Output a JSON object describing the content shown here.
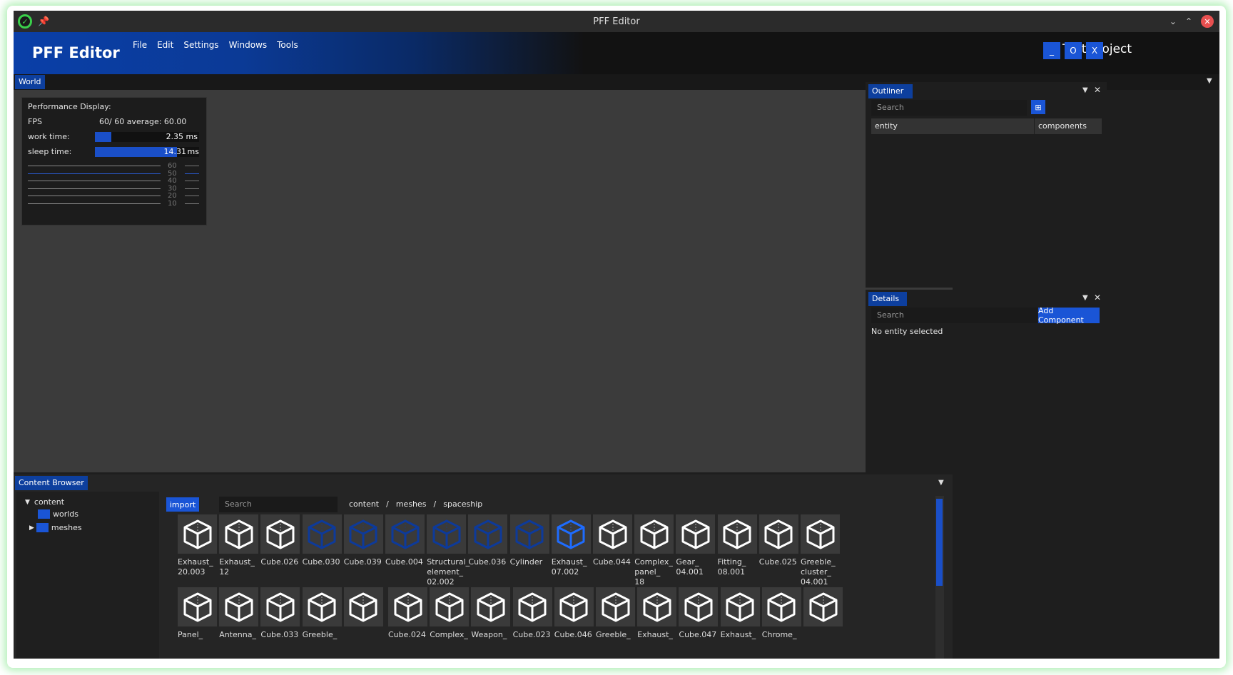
{
  "window": {
    "title": "PFF Editor",
    "app_icon": "app-logo-icon",
    "pin_icon": "pin-icon",
    "min_glyph": "⌄",
    "max_glyph": "⌃",
    "close_glyph": "✕"
  },
  "header": {
    "brand": "PFF Editor",
    "menu": [
      "File",
      "Edit",
      "Settings",
      "Windows",
      "Tools"
    ],
    "project": "Test Project",
    "buttons": [
      "_",
      "O",
      "X"
    ]
  },
  "world_tab": {
    "label": "World"
  },
  "perf": {
    "title": "Performance Display:",
    "fps_label": "FPS",
    "fps_value": "60/  60  average: 60.00",
    "work_label": "work time:",
    "work_value": "2.35 ms",
    "work_fill": 0.16,
    "sleep_label": "sleep time:",
    "sleep_value": "14.31",
    "sleep_unit": "ms",
    "sleep_fill": 0.79,
    "graph_labels": [
      "60",
      "50",
      "40",
      "30",
      "20",
      "10"
    ]
  },
  "outliner": {
    "title": "Outliner",
    "search_placeholder": "Search",
    "col_entity": "entity",
    "col_components": "components"
  },
  "details": {
    "title": "Details",
    "search_placeholder": "Search",
    "add_component": "Add Component",
    "empty": "No entity selected"
  },
  "content_browser": {
    "title": "Content Browser",
    "tree": {
      "root": "content",
      "children": [
        "worlds",
        "meshes"
      ]
    },
    "import": "import",
    "search_placeholder": "Search",
    "path": [
      "content",
      "meshes",
      "spaceship"
    ],
    "path_sep": "/",
    "assets_row1": [
      {
        "label": "Exhaust_\n20.003",
        "style": "white"
      },
      {
        "label": "Exhaust_\n12",
        "style": "white"
      },
      {
        "label": "Cube.026",
        "style": "white"
      },
      {
        "label": "Cube.030",
        "style": "dark"
      },
      {
        "label": "Cube.039",
        "style": "dark"
      },
      {
        "label": "Cube.004",
        "style": "dark"
      },
      {
        "label": "Structural_\nelement_\n02.002",
        "style": "dark"
      },
      {
        "label": "Cube.036",
        "style": "dark"
      },
      {
        "label": "Cylinder",
        "style": "dark"
      },
      {
        "label": "Exhaust_\n07.002",
        "style": "bright"
      },
      {
        "label": "Cube.044",
        "style": "white"
      },
      {
        "label": "Complex_\npanel_\n18",
        "style": "white"
      },
      {
        "label": "Gear_\n04.001",
        "style": "white"
      },
      {
        "label": "Fitting_\n08.001",
        "style": "white"
      },
      {
        "label": "Cube.025",
        "style": "white"
      },
      {
        "label": "Greeble_\ncluster_\n04.001",
        "style": "white"
      }
    ],
    "assets_row2": [
      {
        "label": "Panel_",
        "style": "white"
      },
      {
        "label": "Antenna_",
        "style": "white"
      },
      {
        "label": "Cube.033",
        "style": "white"
      },
      {
        "label": "Greeble_",
        "style": "white"
      },
      {
        "label": "",
        "style": "white"
      },
      {
        "label": "Cube.024",
        "style": "white"
      },
      {
        "label": "Complex_",
        "style": "white"
      },
      {
        "label": "Weapon_",
        "style": "white"
      },
      {
        "label": "Cube.023",
        "style": "white"
      },
      {
        "label": "Cube.046",
        "style": "white"
      },
      {
        "label": "Greeble_",
        "style": "white"
      },
      {
        "label": "Exhaust_",
        "style": "white"
      },
      {
        "label": "Cube.047",
        "style": "white"
      },
      {
        "label": "Exhaust_",
        "style": "white"
      },
      {
        "label": "Chrome_",
        "style": "white"
      },
      {
        "label": "",
        "style": "white"
      }
    ]
  },
  "colors": {
    "accent": "#1a55d6",
    "cube_white": "#ffffff",
    "cube_dark": "#0d3a9a",
    "cube_bright": "#1e6cff"
  }
}
